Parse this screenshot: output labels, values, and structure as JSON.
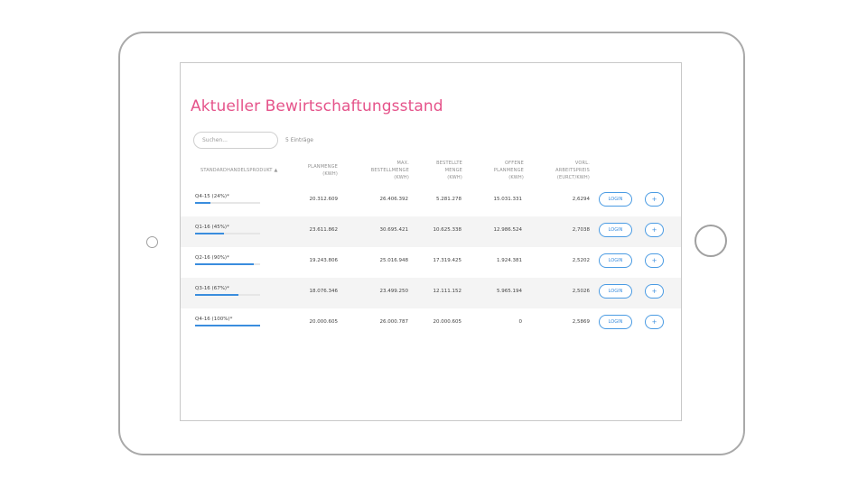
{
  "page": {
    "title": "Aktueller Bewirtschaftungsstand"
  },
  "search": {
    "placeholder": "Suchen...",
    "value": ""
  },
  "entries": {
    "label": "5 Einträge"
  },
  "table": {
    "headers": {
      "product": "STANDARDHANDELSPRODUKT",
      "planmenge": [
        "PLANMENGE",
        "(KWh)"
      ],
      "max_bestellmenge": [
        "MAX.",
        "BESTELLMENGE",
        "(KWh)"
      ],
      "bestellte_menge": [
        "BESTELLTE",
        "MENGE",
        "(KWh)"
      ],
      "offene_planmenge": [
        "OFFENE",
        "PLANMENGE",
        "(KWh)"
      ],
      "vorl_arbeitspreis": [
        "VORL.",
        "ARBEITSPREIS",
        "(EURct/KWh)"
      ]
    },
    "sort_icon": "sort-up-triangle",
    "rows": [
      {
        "product": "Q4-15 (24%)*",
        "progress": 0.24,
        "planmenge": "20.312.609",
        "max_bestellmenge": "26.406.392",
        "bestellte_menge": "5.281.278",
        "offene_planmenge": "15.031.331",
        "vorl_arbeitspreis": "2,6294",
        "login_label": "LOGIN",
        "plus_label": "+"
      },
      {
        "product": "Q1-16 (45%)*",
        "progress": 0.45,
        "planmenge": "23.611.862",
        "max_bestellmenge": "30.695.421",
        "bestellte_menge": "10.625.338",
        "offene_planmenge": "12.986.524",
        "vorl_arbeitspreis": "2,7038",
        "login_label": "LOGIN",
        "plus_label": "+"
      },
      {
        "product": "Q2-16 (90%)*",
        "progress": 0.9,
        "planmenge": "19.243.806",
        "max_bestellmenge": "25.016.948",
        "bestellte_menge": "17.319.425",
        "offene_planmenge": "1.924.381",
        "vorl_arbeitspreis": "2,5202",
        "login_label": "LOGIN",
        "plus_label": "+"
      },
      {
        "product": "Q3-16 (67%)*",
        "progress": 0.67,
        "planmenge": "18.076.346",
        "max_bestellmenge": "23.499.250",
        "bestellte_menge": "12.111.152",
        "offene_planmenge": "5.965.194",
        "vorl_arbeitspreis": "2,5026",
        "login_label": "LOGIN",
        "plus_label": "+"
      },
      {
        "product": "Q4-16 (100%)*",
        "progress": 1.0,
        "planmenge": "20.000.605",
        "max_bestellmenge": "26.000.787",
        "bestellte_menge": "20.000.605",
        "offene_planmenge": "0",
        "vorl_arbeitspreis": "2,5869",
        "login_label": "LOGIN",
        "plus_label": "+"
      }
    ]
  },
  "colors": {
    "title": "#e5538a",
    "accent": "#3a8dde",
    "row_alt": "#f4f4f4"
  }
}
